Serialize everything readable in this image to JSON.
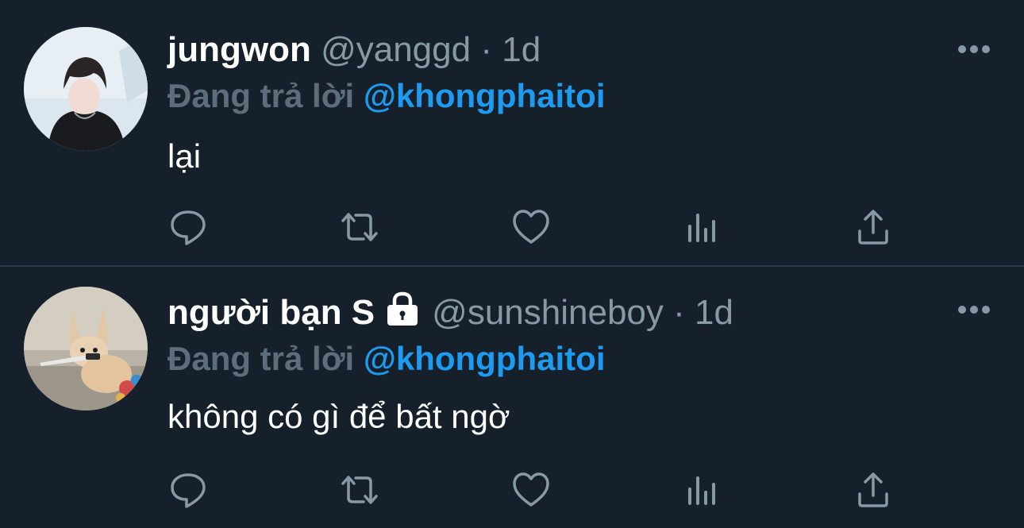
{
  "tweets": [
    {
      "display_name": "jungwon",
      "handle": "@yanggd",
      "separator": "·",
      "time": "1d",
      "locked": false,
      "reply_prefix": "Đang trả lời",
      "reply_to": "@khongphaitoi",
      "text": "lại",
      "avatar": "avatar-photo-person"
    },
    {
      "display_name": "người bạn S",
      "handle": "@sunshineboy",
      "separator": "·",
      "time": "1d",
      "locked": true,
      "reply_prefix": "Đang trả lời",
      "reply_to": "@khongphaitoi",
      "text": "không có gì để bất ngờ",
      "avatar": "avatar-photo-fennec-fox"
    }
  ],
  "actions": [
    "reply-icon",
    "retweet-icon",
    "like-icon",
    "stats-icon",
    "share-icon"
  ],
  "colors": {
    "background": "#15202b",
    "text": "#ffffff",
    "secondary": "#8899a6",
    "reply_prefix": "#5d6d7c",
    "mention": "#1d9bf0",
    "icon": "#8899a6",
    "divider": "#2f3b47"
  }
}
